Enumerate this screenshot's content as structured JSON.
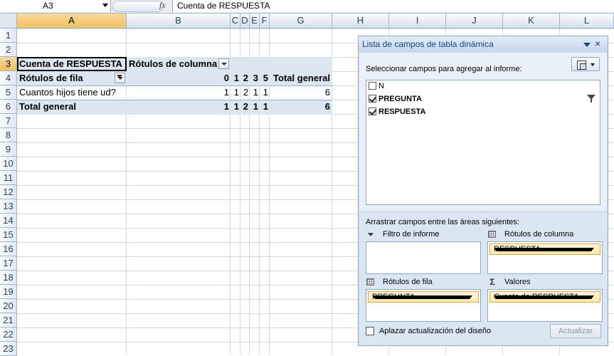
{
  "formula_bar": {
    "name_box": "A3",
    "fx_label": "fx",
    "formula": "Cuenta de RESPUESTA"
  },
  "columns": [
    "A",
    "B",
    "C",
    "D",
    "E",
    "F",
    "G",
    "H",
    "I",
    "J",
    "K",
    "L"
  ],
  "rows": [
    "1",
    "2",
    "3",
    "4",
    "5",
    "6",
    "7",
    "8",
    "9",
    "10",
    "11",
    "12",
    "13",
    "14",
    "15",
    "16",
    "17",
    "18",
    "19",
    "20",
    "21",
    "22",
    "23"
  ],
  "pivot": {
    "values_header": "Cuenta de RESPUESTA",
    "column_labels": "Rótulos de columna",
    "row_labels": "Rótulos de fila",
    "col_values": [
      "0",
      "1",
      "2",
      "3",
      "5"
    ],
    "grand_total_header": "Total general",
    "data_row": {
      "label": "Cuantos hijos tiene ud?",
      "values": [
        "1",
        "1",
        "2",
        "1",
        "1"
      ],
      "total": "6"
    },
    "total_row": {
      "label": "Total general",
      "values": [
        "1",
        "1",
        "2",
        "1",
        "1"
      ],
      "total": "6"
    }
  },
  "field_list": {
    "title": "Lista de campos de tabla dinámica",
    "close": "×",
    "select_label": "Seleccionar campos para agregar al informe:",
    "fields": [
      {
        "name": "N",
        "checked": false
      },
      {
        "name": "PREGUNTA",
        "checked": true
      },
      {
        "name": "RESPUESTA",
        "checked": true
      }
    ],
    "drag_label": "Arrastrar campos entre las áreas siguientes:",
    "areas": {
      "report_filter": {
        "title": "Filtro de informe"
      },
      "column_labels": {
        "title": "Rótulos de columna",
        "item": "RESPUESTA"
      },
      "row_labels": {
        "title": "Rótulos de fila",
        "item": "PREGUNTA"
      },
      "values": {
        "title": "Valores",
        "item": "Cuenta de RESPUESTA"
      }
    },
    "defer_label": "Aplazar actualización del diseño",
    "update_button": "Actualizar"
  }
}
